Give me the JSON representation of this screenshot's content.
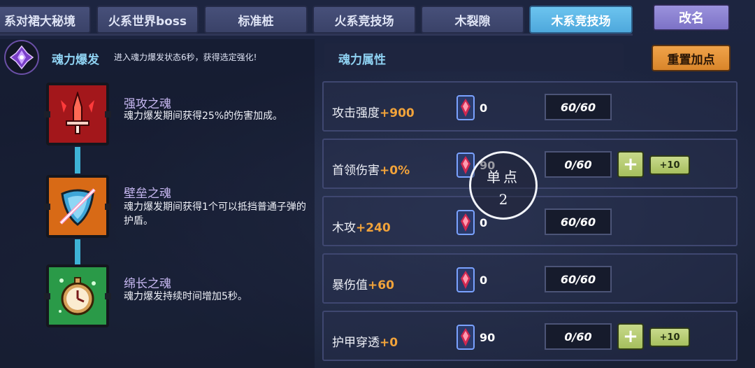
{
  "tabs": [
    {
      "label": "系对裙大秘境",
      "active": false
    },
    {
      "label": "火系世界boss",
      "active": false
    },
    {
      "label": "标准桩",
      "active": false
    },
    {
      "label": "火系竞技场",
      "active": false
    },
    {
      "label": "木裂隙",
      "active": false
    },
    {
      "label": "木系竞技场",
      "active": true
    }
  ],
  "rename_label": "改名",
  "burst": {
    "name": "魂力爆发",
    "description": "进入魂力爆发状态6秒，获得选定强化!"
  },
  "skills": [
    {
      "title": "强攻之魂",
      "desc": "魂力爆发期间获得25%的伤害加成。",
      "icon": "sword-icon",
      "color": "#a3171b"
    },
    {
      "title": "壁垒之魂",
      "desc": "魂力爆发期间获得1个可以抵挡普通子弹的护盾。",
      "icon": "shield-icon",
      "color": "#d86a16"
    },
    {
      "title": "绵长之魂",
      "desc": "魂力爆发持续时间增加5秒。",
      "icon": "clock-icon",
      "color": "#2a9a48"
    }
  ],
  "attr_section_title": "魂力属性",
  "reset_label": "重置加点",
  "attributes": [
    {
      "name": "攻击强度",
      "bonus": "+900",
      "gems": "0",
      "cap": "60/60",
      "show_add": false
    },
    {
      "name": "首领伤害",
      "bonus": "+0%",
      "gems": "90",
      "cap": "0/60",
      "show_add": true
    },
    {
      "name": "木攻",
      "bonus": "+240",
      "gems": "0",
      "cap": "60/60",
      "show_add": false
    },
    {
      "name": "暴伤值",
      "bonus": "+60",
      "gems": "0",
      "cap": "60/60",
      "show_add": false
    },
    {
      "name": "护甲穿透",
      "bonus": "+0",
      "gems": "90",
      "cap": "0/60",
      "show_add": true
    }
  ],
  "add_label": "+",
  "add10_label": "+10",
  "tap_overlay": {
    "label": "单点",
    "count": "2"
  }
}
